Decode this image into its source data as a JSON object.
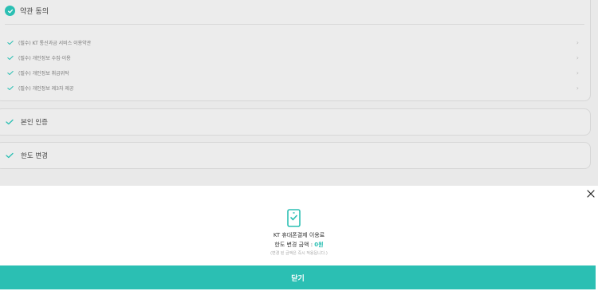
{
  "terms": {
    "title": "약관 동의",
    "items": [
      {
        "label": "(필수) KT 통신과금 서비스 이용약관"
      },
      {
        "label": "(필수) 개인정보 수집·이용"
      },
      {
        "label": "(필수) 개인정보 취급위탁"
      },
      {
        "label": "(필수) 개인정보 제3자 제공"
      }
    ]
  },
  "sections": {
    "identity_label": "본인 인증",
    "limit_label": "한도 변경"
  },
  "sheet": {
    "line1": "KT 휴대폰결제 이용료",
    "line2_prefix": "한도 변경 금액 : ",
    "amount": "0원",
    "note": "(변경 된 금액은 즉시 적용됩니다.)",
    "confirm_label": "닫기",
    "icons": {
      "close": "close-icon",
      "phone": "phone-check-icon",
      "check": "check-icon",
      "chevron": "chevron-right-icon"
    }
  },
  "colors": {
    "accent": "#2bbfb3",
    "background": "#e9e9e9",
    "sheet": "#ffffff"
  }
}
